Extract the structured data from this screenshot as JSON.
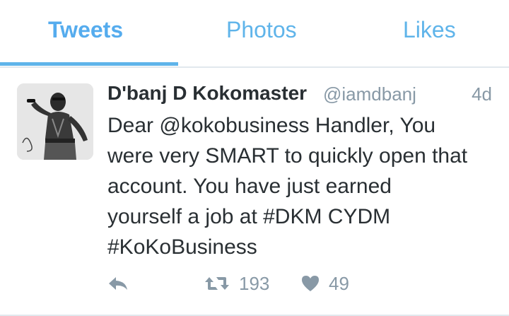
{
  "tabs": [
    {
      "label": "Tweets",
      "active": true
    },
    {
      "label": "Photos",
      "active": false
    },
    {
      "label": "Likes",
      "active": false
    }
  ],
  "tweet": {
    "author_name": "D'banj D Kokomaster",
    "handle": "@iamdbanj",
    "time": "4d",
    "text_lines": [
      "Dear @kokobusiness Handler, You",
      "were very SMART to quickly open that",
      "account. You have just earned",
      "yourself a job at #DKM CYDM",
      "#KoKoBusiness"
    ],
    "retweet_count": "193",
    "like_count": "49"
  },
  "icons": {
    "reply": "reply-icon",
    "retweet": "retweet-icon",
    "like": "heart-icon",
    "avatar": "profile-photo"
  },
  "colors": {
    "accent": "#55acee",
    "text": "#292f33",
    "muted": "#8899a6",
    "divider": "#e1e8ed"
  }
}
